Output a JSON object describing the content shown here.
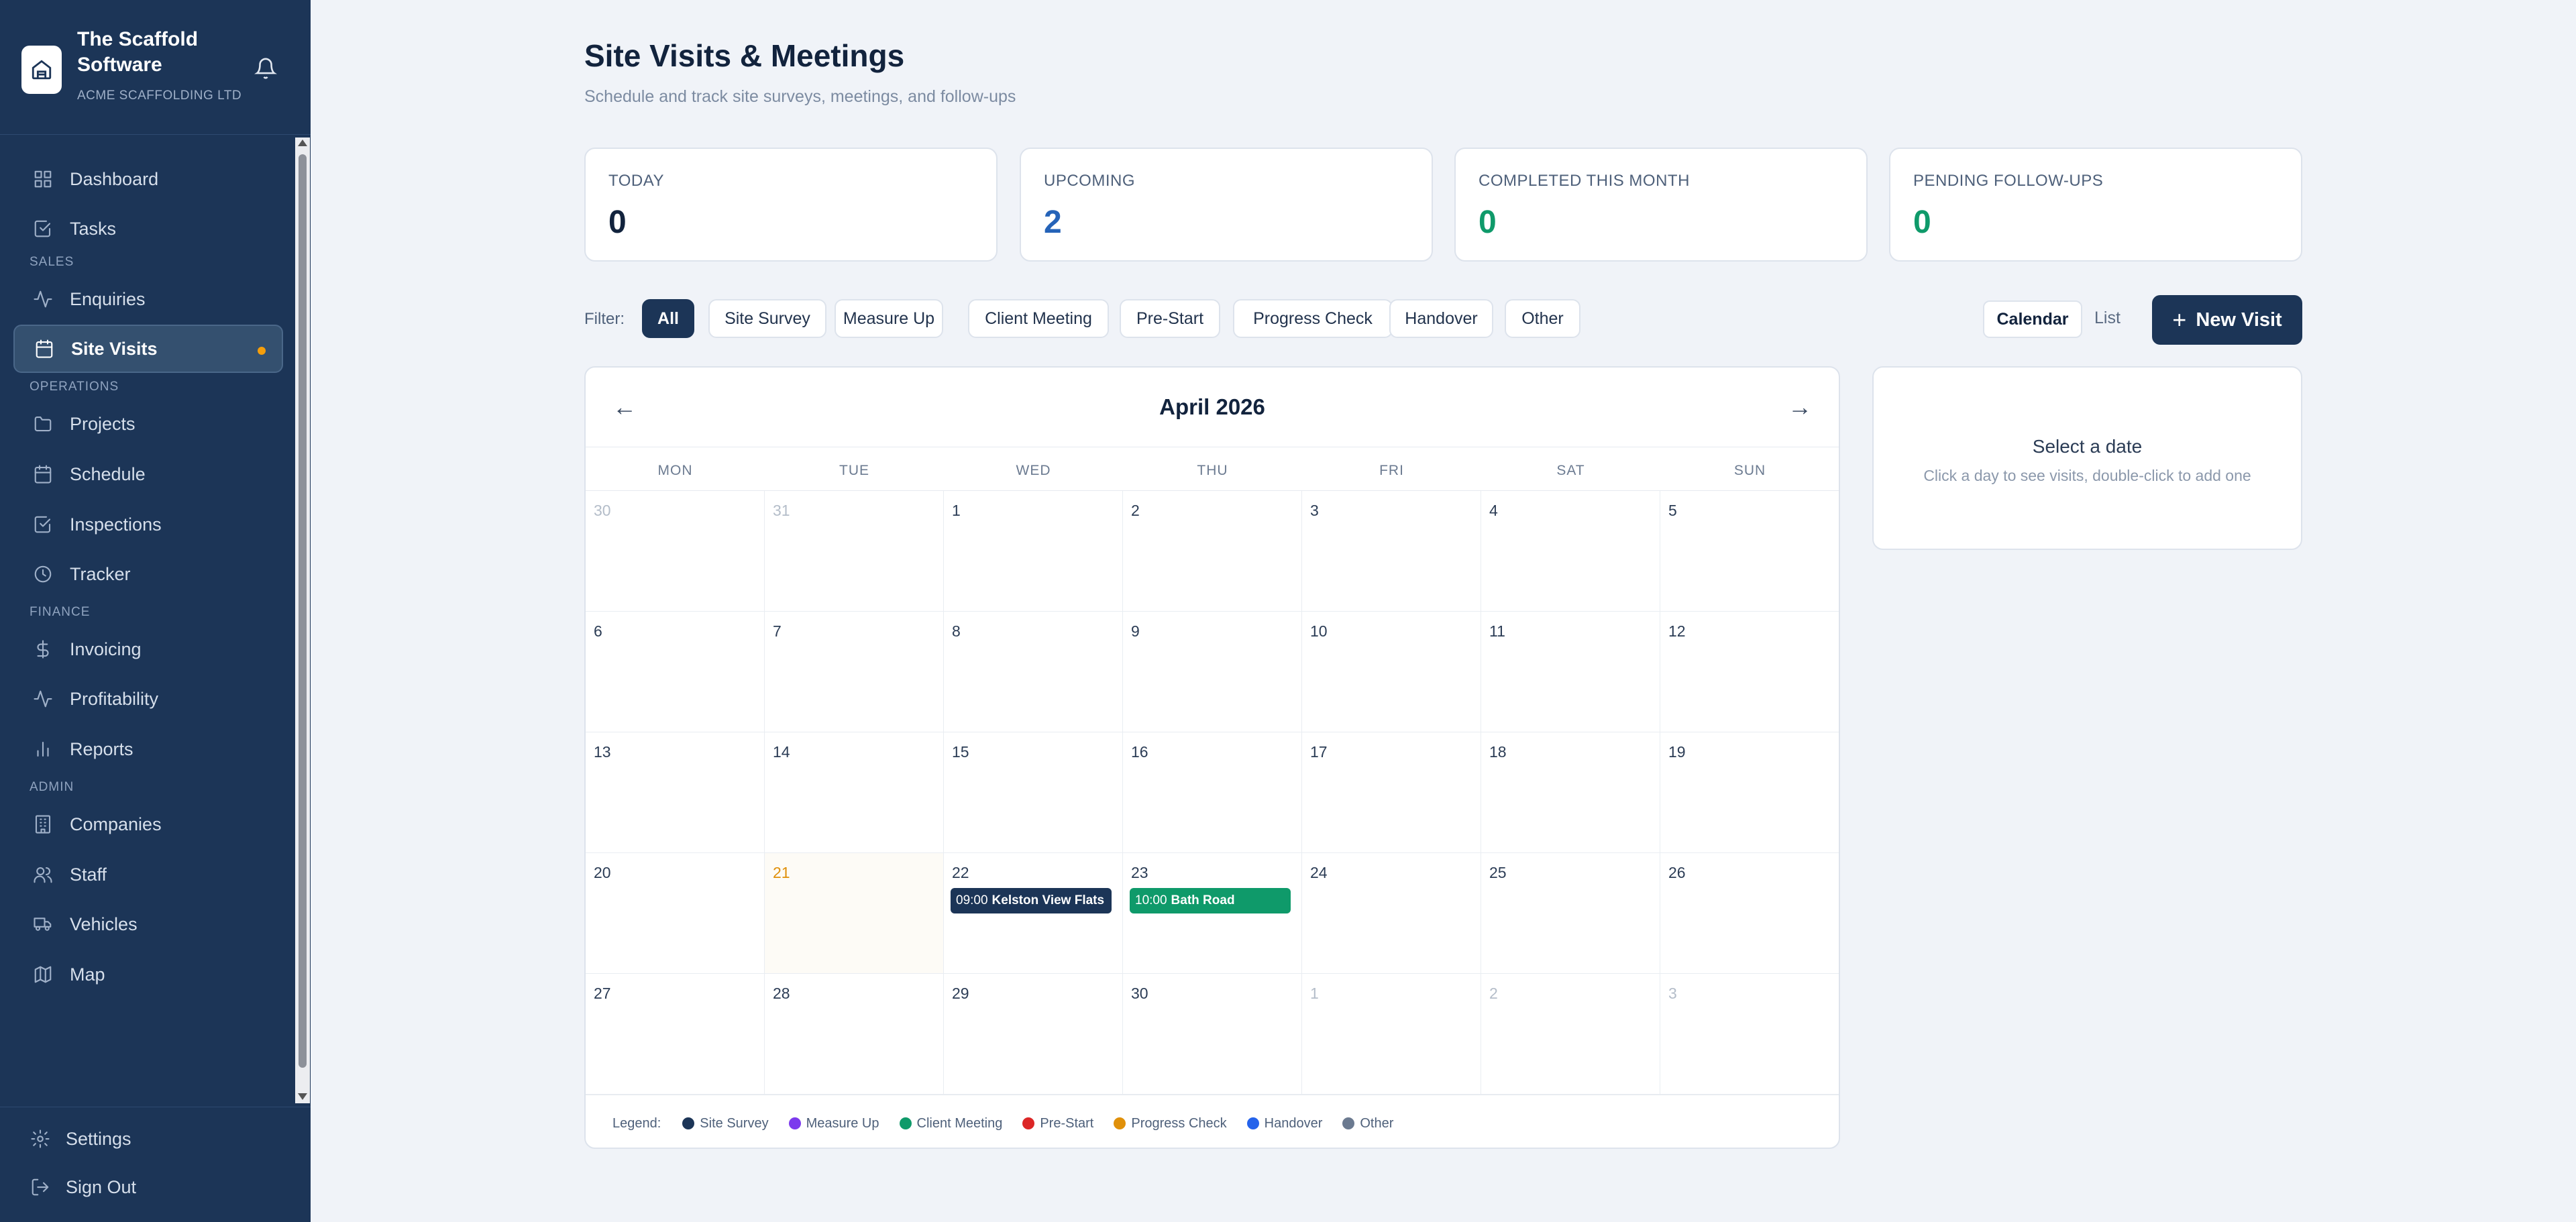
{
  "brand": {
    "name": "The Scaffold Software",
    "company": "ACME SCAFFOLDING LTD"
  },
  "sidebar": {
    "items": [
      {
        "label": "Dashboard",
        "icon": "grid-icon"
      },
      {
        "label": "Tasks",
        "icon": "checkbox-icon"
      },
      {
        "section": "SALES"
      },
      {
        "label": "Enquiries",
        "icon": "activity-icon"
      },
      {
        "label": "Site Visits",
        "icon": "calendar-icon",
        "active": true
      },
      {
        "section": "OPERATIONS"
      },
      {
        "label": "Projects",
        "icon": "folder-icon"
      },
      {
        "label": "Schedule",
        "icon": "calendar-icon"
      },
      {
        "label": "Inspections",
        "icon": "checkbox-icon"
      },
      {
        "label": "Tracker",
        "icon": "clock-icon"
      },
      {
        "section": "FINANCE"
      },
      {
        "label": "Invoicing",
        "icon": "dollar-icon"
      },
      {
        "label": "Profitability",
        "icon": "activity-icon"
      },
      {
        "label": "Reports",
        "icon": "bar-chart-icon"
      },
      {
        "section": "ADMIN"
      },
      {
        "label": "Companies",
        "icon": "building-icon"
      },
      {
        "label": "Staff",
        "icon": "users-icon"
      },
      {
        "label": "Vehicles",
        "icon": "truck-icon"
      },
      {
        "label": "Map",
        "icon": "map-icon"
      }
    ],
    "bottom": [
      {
        "label": "Settings",
        "icon": "gear-icon"
      },
      {
        "label": "Sign Out",
        "icon": "logout-icon"
      }
    ]
  },
  "header": {
    "title": "Site Visits & Meetings",
    "subtitle": "Schedule and track site surveys, meetings, and follow-ups"
  },
  "stats": [
    {
      "label": "TODAY",
      "value": "0",
      "color": "#12233d"
    },
    {
      "label": "UPCOMING",
      "value": "2",
      "color": "#2563b8"
    },
    {
      "label": "COMPLETED THIS MONTH",
      "value": "0",
      "color": "#0f9a6a"
    },
    {
      "label": "PENDING FOLLOW-UPS",
      "value": "0",
      "color": "#0f9a6a"
    }
  ],
  "filters": {
    "label": "Filter:",
    "options": [
      "All",
      "Site Survey",
      "Measure Up",
      "Client Meeting",
      "Pre-Start",
      "Progress Check",
      "Handover",
      "Other"
    ],
    "active": "All"
  },
  "view": {
    "calendar": "Calendar",
    "list": "List",
    "new_visit": "New Visit"
  },
  "calendar": {
    "month": "April 2026",
    "prev": "←",
    "next": "→",
    "weekdays": [
      "MON",
      "TUE",
      "WED",
      "THU",
      "FRI",
      "SAT",
      "SUN"
    ],
    "weeks": [
      [
        {
          "d": "30",
          "o": true
        },
        {
          "d": "31",
          "o": true
        },
        {
          "d": "1"
        },
        {
          "d": "2"
        },
        {
          "d": "3"
        },
        {
          "d": "4"
        },
        {
          "d": "5"
        }
      ],
      [
        {
          "d": "6"
        },
        {
          "d": "7"
        },
        {
          "d": "8"
        },
        {
          "d": "9"
        },
        {
          "d": "10"
        },
        {
          "d": "11"
        },
        {
          "d": "12"
        }
      ],
      [
        {
          "d": "13"
        },
        {
          "d": "14"
        },
        {
          "d": "15"
        },
        {
          "d": "16"
        },
        {
          "d": "17"
        },
        {
          "d": "18"
        },
        {
          "d": "19"
        }
      ],
      [
        {
          "d": "20"
        },
        {
          "d": "21",
          "today": true
        },
        {
          "d": "22",
          "event": {
            "time": "09:00",
            "title": "Kelston View Flats",
            "color": "#1c3557"
          }
        },
        {
          "d": "23",
          "event": {
            "time": "10:00",
            "title": "Bath Road",
            "color": "#0f9a6a"
          }
        },
        {
          "d": "24"
        },
        {
          "d": "25"
        },
        {
          "d": "26"
        }
      ],
      [
        {
          "d": "27"
        },
        {
          "d": "28"
        },
        {
          "d": "29"
        },
        {
          "d": "30"
        },
        {
          "d": "1",
          "o": true
        },
        {
          "d": "2",
          "o": true
        },
        {
          "d": "3",
          "o": true
        }
      ]
    ],
    "legend_label": "Legend:",
    "legend": [
      {
        "label": "Site Survey",
        "color": "#1c3557"
      },
      {
        "label": "Measure Up",
        "color": "#7c3aed"
      },
      {
        "label": "Client Meeting",
        "color": "#0f9a6a"
      },
      {
        "label": "Pre-Start",
        "color": "#dc2626"
      },
      {
        "label": "Progress Check",
        "color": "#e0900a"
      },
      {
        "label": "Handover",
        "color": "#2563eb"
      },
      {
        "label": "Other",
        "color": "#6b7a90"
      }
    ]
  },
  "side_panel": {
    "title": "Select a date",
    "subtitle": "Click a day to see visits, double-click to add one"
  }
}
